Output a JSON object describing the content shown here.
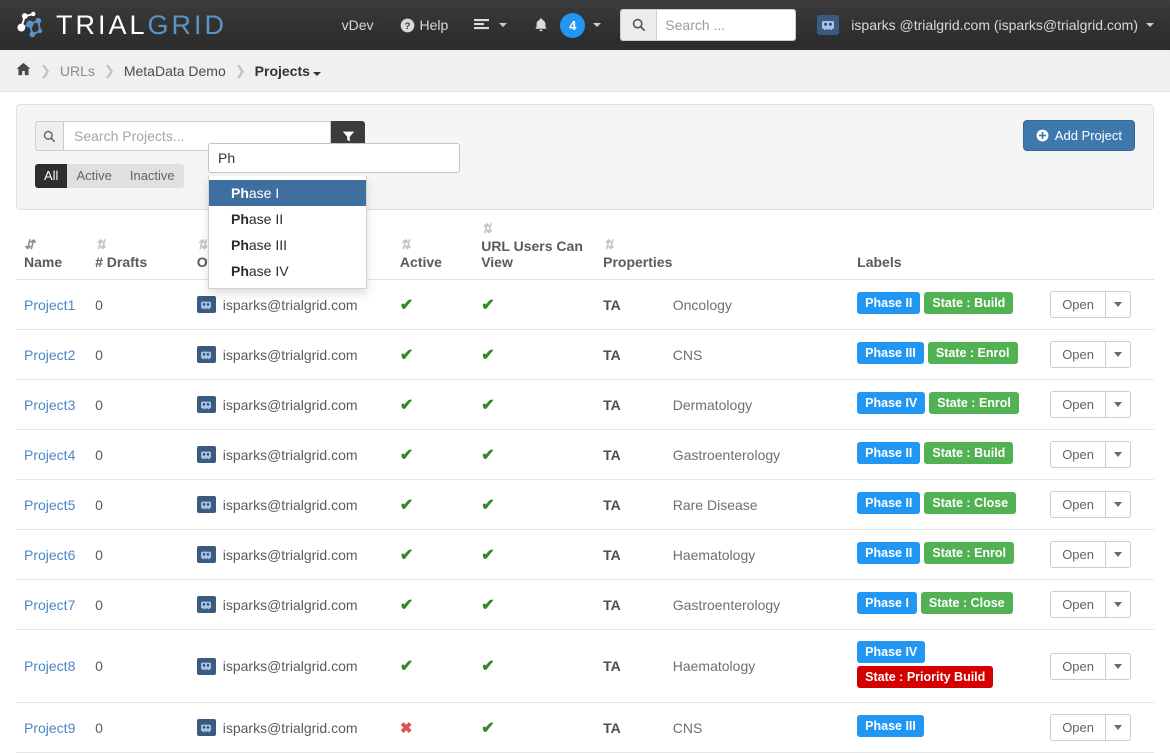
{
  "brand": {
    "text_primary": "TRIAL",
    "text_secondary": "GRID",
    "logo_icon": "node-graph-icon"
  },
  "navbar": {
    "version_label": "vDev",
    "help_label": "Help",
    "help_icon": "question-circle-icon",
    "list_icon": "align-left-icon",
    "bell_icon": "bell-icon",
    "notification_count": "4",
    "search_icon": "search-icon",
    "search_placeholder": "Search ...",
    "search_value": "",
    "user_label": "isparks @trialgrid.com (isparks@trialgrid.com)",
    "user_icon": "user-avatar-icon"
  },
  "breadcrumb": {
    "home_icon": "home-icon",
    "separator": "❯",
    "items": [
      {
        "label": "URLs",
        "style": "muted"
      },
      {
        "label": "MetaData Demo",
        "style": "link"
      },
      {
        "label": "Projects",
        "style": "strong",
        "caret": true
      }
    ]
  },
  "toolbar": {
    "search_placeholder": "Search Projects...",
    "search_value": "",
    "search_icon": "search-icon",
    "filter_icon": "filter-icon",
    "filters": [
      {
        "label": "All",
        "active": true
      },
      {
        "label": "Active",
        "active": false
      },
      {
        "label": "Inactive",
        "active": false
      }
    ],
    "add_button": {
      "label": "Add Project",
      "icon": "plus-circle-icon"
    }
  },
  "autocomplete": {
    "value": "Ph",
    "match_prefix": "Ph",
    "options": [
      {
        "label": "Phase I",
        "selected": true
      },
      {
        "label": "Phase II",
        "selected": false
      },
      {
        "label": "Phase III",
        "selected": false
      },
      {
        "label": "Phase IV",
        "selected": false
      }
    ]
  },
  "table": {
    "columns": [
      {
        "key": "name",
        "label": "Name",
        "sort_icon": "sort-amount-asc-icon",
        "sort_active": true
      },
      {
        "key": "drafts",
        "label": "# Drafts",
        "sort_icon": "sort-icon",
        "sort_active": false
      },
      {
        "key": "owner",
        "label": "Owner",
        "sort_icon": "sort-icon",
        "sort_active": false
      },
      {
        "key": "active",
        "label": "Active",
        "sort_icon": "sort-icon",
        "sort_active": false
      },
      {
        "key": "view",
        "label": "URL Users Can View",
        "sort_icon": "sort-icon",
        "sort_active": false
      },
      {
        "key": "properties",
        "label": "Properties",
        "sort_icon": "sort-icon",
        "sort_active": false
      },
      {
        "key": "labels",
        "label": "Labels",
        "sort_icon": "",
        "sort_active": false
      },
      {
        "key": "actions",
        "label": "",
        "sort_icon": "",
        "sort_active": false
      }
    ],
    "row_action": {
      "label": "Open",
      "caret_icon": "caret-down-icon"
    },
    "property_key": "TA",
    "rows": [
      {
        "name": "Project1",
        "drafts": "0",
        "owner": "isparks@trialgrid.com",
        "active": true,
        "view": true,
        "prop_key": "TA",
        "prop_value": "Oncology",
        "labels": [
          {
            "text": "Phase II",
            "color": "#2196f3"
          },
          {
            "text": "State : Build",
            "color": "#52b152"
          }
        ]
      },
      {
        "name": "Project2",
        "drafts": "0",
        "owner": "isparks@trialgrid.com",
        "active": true,
        "view": true,
        "prop_key": "TA",
        "prop_value": "CNS",
        "labels": [
          {
            "text": "Phase III",
            "color": "#2196f3"
          },
          {
            "text": "State : Enrol",
            "color": "#52b152"
          }
        ]
      },
      {
        "name": "Project3",
        "drafts": "0",
        "owner": "isparks@trialgrid.com",
        "active": true,
        "view": true,
        "prop_key": "TA",
        "prop_value": "Dermatology",
        "labels": [
          {
            "text": "Phase IV",
            "color": "#2196f3"
          },
          {
            "text": "State : Enrol",
            "color": "#52b152"
          }
        ]
      },
      {
        "name": "Project4",
        "drafts": "0",
        "owner": "isparks@trialgrid.com",
        "active": true,
        "view": true,
        "prop_key": "TA",
        "prop_value": "Gastroenterology",
        "labels": [
          {
            "text": "Phase II",
            "color": "#2196f3"
          },
          {
            "text": "State : Build",
            "color": "#52b152"
          }
        ]
      },
      {
        "name": "Project5",
        "drafts": "0",
        "owner": "isparks@trialgrid.com",
        "active": true,
        "view": true,
        "prop_key": "TA",
        "prop_value": "Rare Disease",
        "labels": [
          {
            "text": "Phase II",
            "color": "#2196f3"
          },
          {
            "text": "State : Close",
            "color": "#52b152"
          }
        ]
      },
      {
        "name": "Project6",
        "drafts": "0",
        "owner": "isparks@trialgrid.com",
        "active": true,
        "view": true,
        "prop_key": "TA",
        "prop_value": "Haematology",
        "labels": [
          {
            "text": "Phase II",
            "color": "#2196f3"
          },
          {
            "text": "State : Enrol",
            "color": "#52b152"
          }
        ]
      },
      {
        "name": "Project7",
        "drafts": "0",
        "owner": "isparks@trialgrid.com",
        "active": true,
        "view": true,
        "prop_key": "TA",
        "prop_value": "Gastroenterology",
        "labels": [
          {
            "text": "Phase I",
            "color": "#2196f3"
          },
          {
            "text": "State : Close",
            "color": "#52b152"
          }
        ]
      },
      {
        "name": "Project8",
        "drafts": "0",
        "owner": "isparks@trialgrid.com",
        "active": true,
        "view": true,
        "prop_key": "TA",
        "prop_value": "Haematology",
        "labels": [
          {
            "text": "Phase IV",
            "color": "#2196f3"
          },
          {
            "text": "State : Priority Build",
            "color": "#d40000"
          }
        ]
      },
      {
        "name": "Project9",
        "drafts": "0",
        "owner": "isparks@trialgrid.com",
        "active": false,
        "view": true,
        "prop_key": "TA",
        "prop_value": "CNS",
        "labels": [
          {
            "text": "Phase III",
            "color": "#2196f3"
          }
        ]
      }
    ]
  },
  "icons": {
    "tick": "✔",
    "cross": "✖",
    "sort": "⇅",
    "sort_amount_asc": "⇓"
  }
}
